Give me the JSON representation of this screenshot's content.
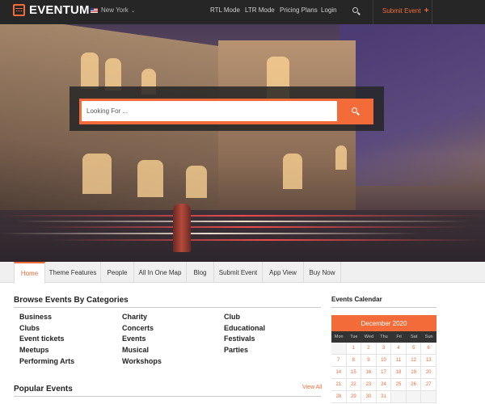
{
  "brand": {
    "name": "EVENTUM",
    "accent": "#f26b38",
    "topbar_bg": "#262626"
  },
  "location": {
    "city": "New York",
    "flag_icon": "us-flag-icon"
  },
  "top_nav": [
    {
      "label": "RTL Mode"
    },
    {
      "label": "LTR Mode"
    },
    {
      "label": "Pricing Plans"
    },
    {
      "label": "Login"
    }
  ],
  "submit_event_label": "Submit Event",
  "hero_search": {
    "placeholder": "Looking For ..."
  },
  "tabs": [
    {
      "label": "Home",
      "active": true
    },
    {
      "label": "Theme Features"
    },
    {
      "label": "People"
    },
    {
      "label": "All In One Map"
    },
    {
      "label": "Blog"
    },
    {
      "label": "Submit Event"
    },
    {
      "label": "App View"
    },
    {
      "label": "Buy Now"
    }
  ],
  "categories": {
    "title": "Browse Events By Categories",
    "items": [
      "Business",
      "Clubs",
      "Event tickets",
      "Meetups",
      "Performing Arts",
      "Charity",
      "Concerts",
      "Events",
      "Musical",
      "Workshops",
      "Club",
      "Educational",
      "Festivals",
      "Parties"
    ]
  },
  "popular": {
    "title": "Popular Events",
    "view_all": "View All"
  },
  "calendar": {
    "title": "Events Calendar",
    "month": "December 2020",
    "weekdays": [
      "Mon",
      "Tue",
      "Wed",
      "Thu",
      "Fri",
      "Sat",
      "Sun"
    ],
    "days": [
      "",
      "1",
      "2",
      "3",
      "4",
      "5",
      "6",
      "7",
      "8",
      "9",
      "10",
      "11",
      "12",
      "13",
      "14",
      "15",
      "16",
      "17",
      "18",
      "19",
      "20",
      "21",
      "22",
      "23",
      "24",
      "25",
      "26",
      "27",
      "28",
      "29",
      "30",
      "31",
      "",
      "",
      ""
    ]
  }
}
